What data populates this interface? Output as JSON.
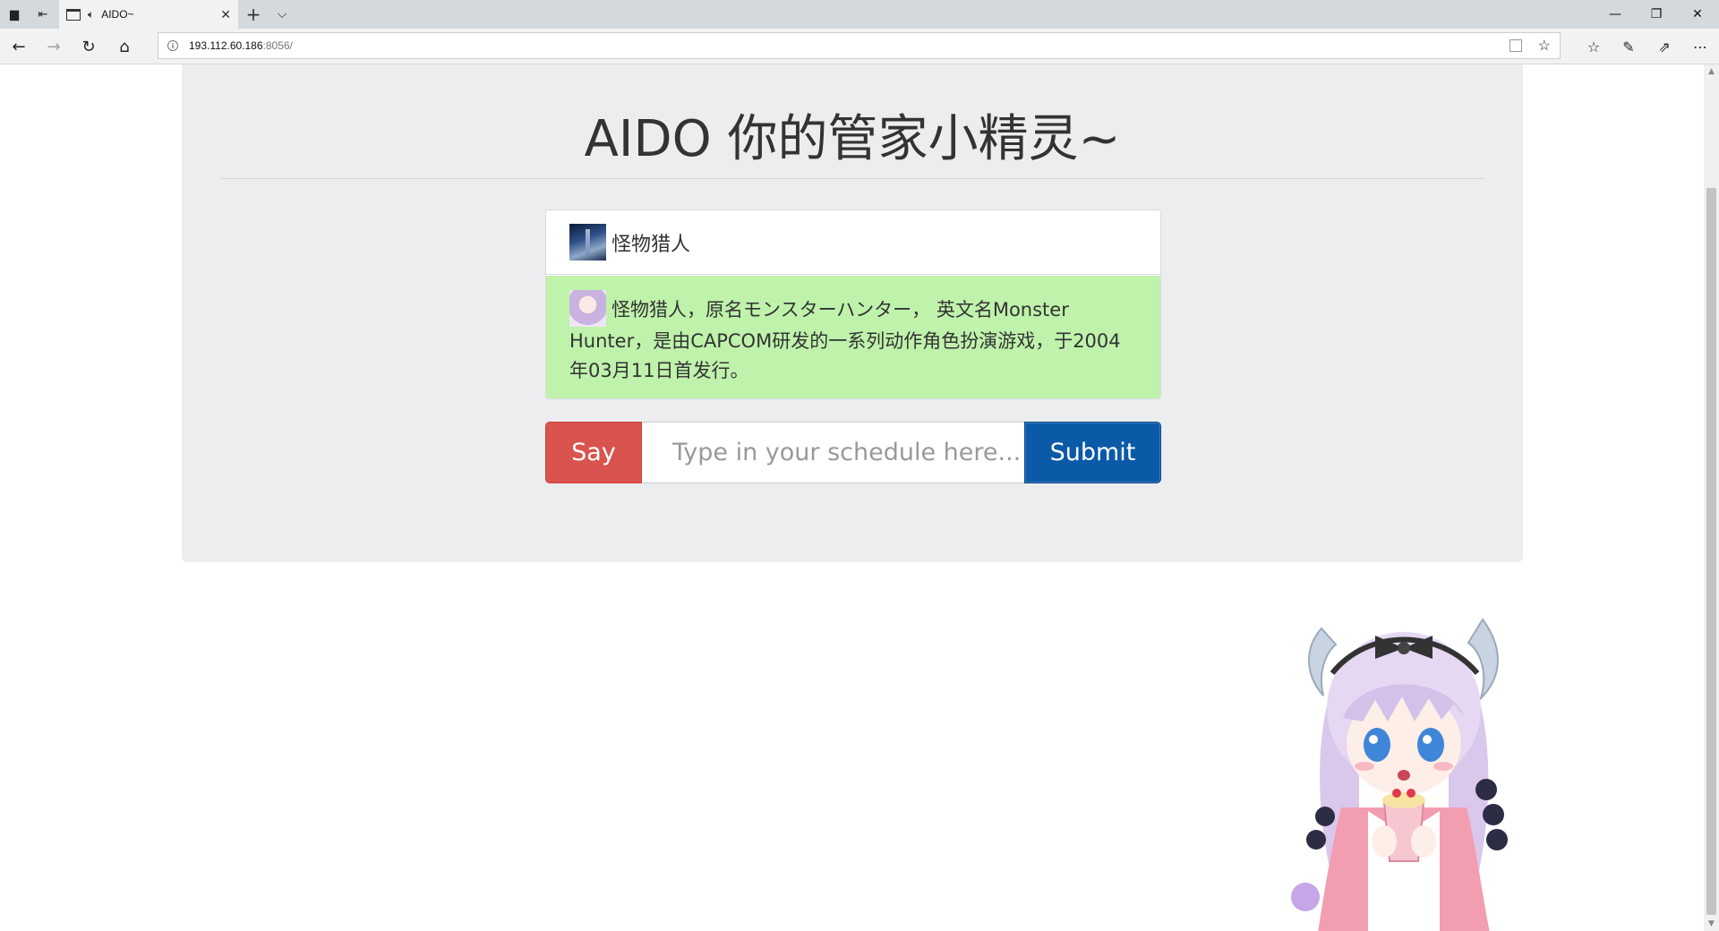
{
  "browser": {
    "tab_title": "AIDO~",
    "tab_close": "✕",
    "new_tab": "+",
    "tab_list": "⌵",
    "url_host": "193.112.60.186",
    "url_port": ":8056/",
    "win_minimize": "—",
    "win_restore": "❐",
    "win_close": "✕"
  },
  "page": {
    "title": "AIDO 你的管家小精灵~"
  },
  "chat": {
    "user_message": "怪物猎人",
    "bot_message": "怪物猎人，原名モンスターハンター， 英文名Monster Hunter，是由CAPCOM研发的一系列动作角色扮演游戏，于2004年03月11日首发行。"
  },
  "form": {
    "say_label": "Say",
    "input_placeholder": "Type in your schedule here...",
    "input_value": "",
    "submit_label": "Submit"
  },
  "colors": {
    "say_button": "#d9534f",
    "submit_button": "#0a5aa8",
    "bot_bubble": "#bff2ab",
    "jumbotron": "#ebedef"
  },
  "icons": {
    "back": "back-arrow-icon",
    "forward": "forward-arrow-icon",
    "refresh": "refresh-icon",
    "home": "home-icon",
    "favorite": "star-icon",
    "favorites_list": "favorites-list-icon",
    "notes": "pen-icon",
    "share": "share-icon",
    "more": "more-icon"
  }
}
